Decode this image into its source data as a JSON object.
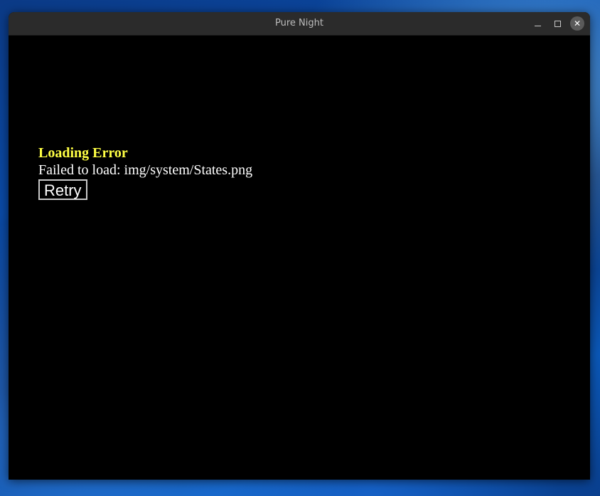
{
  "window": {
    "title": "Pure Night",
    "controls": {
      "minimize_icon": "minimize-icon",
      "maximize_icon": "maximize-icon",
      "close_icon": "close-icon",
      "close_glyph": "✕"
    }
  },
  "error": {
    "title": "Loading Error",
    "message": "Failed to load: img/system/States.png",
    "retry_label": "Retry"
  },
  "colors": {
    "error_title": "#ffff44",
    "error_message": "#ffffff",
    "background": "#000000"
  }
}
